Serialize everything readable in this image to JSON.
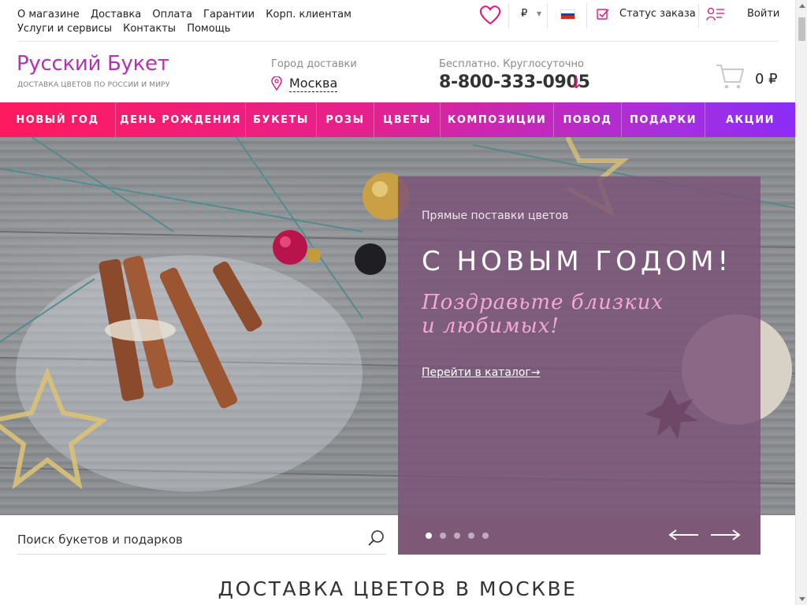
{
  "top_links": [
    "О магазине",
    "Доставка",
    "Оплата",
    "Гарантии",
    "Корп. клиентам",
    "Услуги и сервисы",
    "Контакты",
    "Помощь"
  ],
  "topbar": {
    "currency": "₽",
    "order_status": "Статус заказа",
    "login": "Войти"
  },
  "header": {
    "logo_title": "Русский Букет",
    "logo_subtitle": "ДОСТАВКА ЦВЕТОВ ПО РОССИИ И МИРУ",
    "city_label": "Город доставки",
    "city": "Москва",
    "phone_label": "Бесплатно. Круглосуточно",
    "phone": "8-800-333-0905",
    "phone_arrow": "↓",
    "cart_total": "0 ₽"
  },
  "nav": [
    "НОВЫЙ ГОД",
    "ДЕНЬ РОЖДЕНИЯ",
    "БУКЕТЫ",
    "РОЗЫ",
    "ЦВЕТЫ",
    "КОМПОЗИЦИИ",
    "ПОВОД",
    "ПОДАРКИ",
    "АКЦИИ"
  ],
  "hero": {
    "pretitle": "Прямые поставки цветов",
    "title": "С НОВЫМ ГОДОМ!",
    "subtitle": "Поздравьте близких и любимых!",
    "link": "Перейти в каталог→",
    "slides_count": 5,
    "active_slide": 1
  },
  "search": {
    "placeholder": "Поиск букетов и подарков"
  },
  "section_title": "ДОСТАВКА ЦВЕТОВ В МОСКВЕ",
  "colors": {
    "brand": "#b62fb6",
    "accent": "#e0197d",
    "nav_start": "#ff1a5e",
    "nav_end": "#8b2cf5",
    "panel": "#7a5278"
  },
  "icons": [
    "heart-icon",
    "flag-ru-icon",
    "checkbox-icon",
    "user-list-icon",
    "map-pin-icon",
    "cart-icon",
    "search-icon",
    "arrow-left-icon",
    "arrow-right-icon"
  ]
}
